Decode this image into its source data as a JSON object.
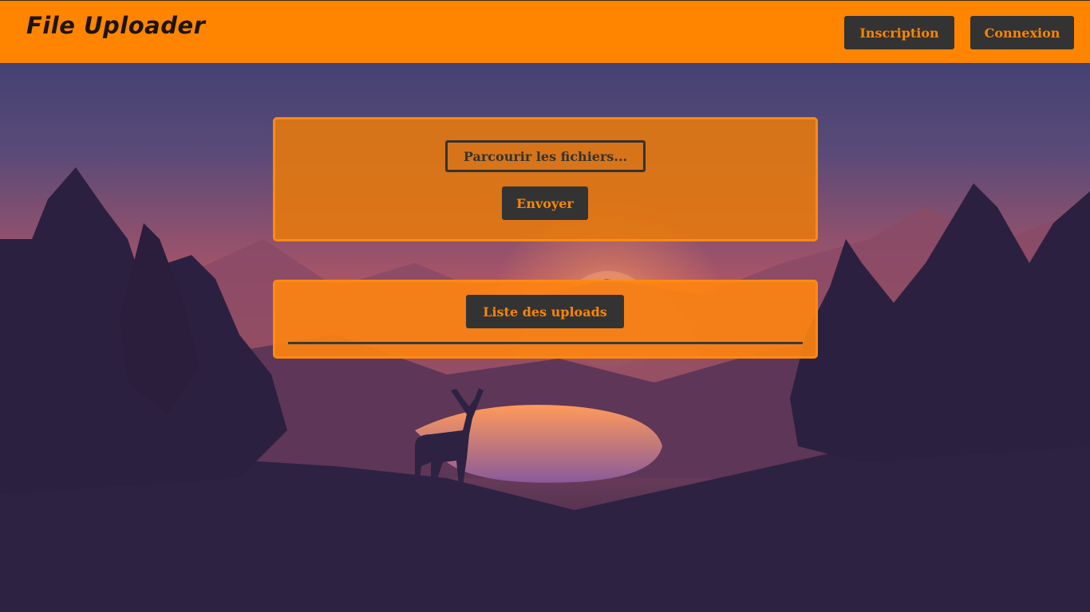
{
  "header": {
    "title": "File Uploader",
    "nav": {
      "signup_label": "Inscription",
      "login_label": "Connexion"
    }
  },
  "upload": {
    "browse_label": "Parcourir les fichiers...",
    "send_label": "Envoyer"
  },
  "uploads_list": {
    "title": "Liste des uploads",
    "items": []
  },
  "background": {
    "scene": "background-image",
    "colors": {
      "sky_top": "#3a3e6c",
      "sky_mid": "#8e4a68",
      "horizon": "#e0764a",
      "dark": "#2d2140"
    }
  },
  "colors": {
    "accent": "#ff8500",
    "button_bg": "#333333",
    "text_dark": "#1c1410"
  }
}
